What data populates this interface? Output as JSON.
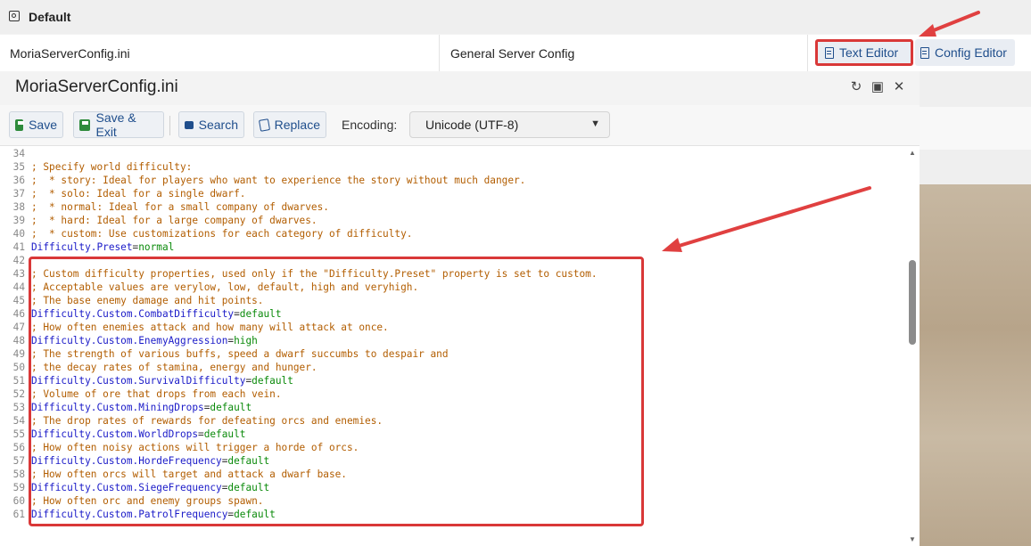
{
  "header": {
    "title": "Default"
  },
  "config_row": {
    "filename": "MoriaServerConfig.ini",
    "description": "General Server Config",
    "text_editor_label": "Text Editor",
    "config_editor_label": "Config Editor"
  },
  "editor": {
    "window_title": "MoriaServerConfig.ini",
    "toolbar": {
      "save": "Save",
      "save_exit": "Save & Exit",
      "search": "Search",
      "replace": "Replace",
      "encoding_label": "Encoding:",
      "encoding_value": "Unicode (UTF-8)"
    },
    "lines": [
      {
        "n": "34",
        "type": "blank",
        "text": ""
      },
      {
        "n": "35",
        "type": "comment",
        "text": "; Specify world difficulty:"
      },
      {
        "n": "36",
        "type": "comment",
        "text": ";  * story: Ideal for players who want to experience the story without much danger."
      },
      {
        "n": "37",
        "type": "comment",
        "text": ";  * solo: Ideal for a single dwarf."
      },
      {
        "n": "38",
        "type": "comment",
        "text": ";  * normal: Ideal for a small company of dwarves."
      },
      {
        "n": "39",
        "type": "comment",
        "text": ";  * hard: Ideal for a large company of dwarves."
      },
      {
        "n": "40",
        "type": "comment",
        "text": ";  * custom: Use customizations for each category of difficulty."
      },
      {
        "n": "41",
        "type": "kv",
        "key": "Difficulty.Preset",
        "value": "normal"
      },
      {
        "n": "42",
        "type": "blank",
        "text": ""
      },
      {
        "n": "43",
        "type": "comment",
        "text": "; Custom difficulty properties, used only if the \"Difficulty.Preset\" property is set to custom."
      },
      {
        "n": "44",
        "type": "comment",
        "text": "; Acceptable values are verylow, low, default, high and veryhigh."
      },
      {
        "n": "45",
        "type": "comment",
        "text": "; The base enemy damage and hit points."
      },
      {
        "n": "46",
        "type": "kv",
        "key": "Difficulty.Custom.CombatDifficulty",
        "value": "default"
      },
      {
        "n": "47",
        "type": "comment",
        "text": "; How often enemies attack and how many will attack at once."
      },
      {
        "n": "48",
        "type": "kv",
        "key": "Difficulty.Custom.EnemyAggression",
        "value": "high"
      },
      {
        "n": "49",
        "type": "comment",
        "text": "; The strength of various buffs, speed a dwarf succumbs to despair and"
      },
      {
        "n": "50",
        "type": "comment",
        "text": "; the decay rates of stamina, energy and hunger."
      },
      {
        "n": "51",
        "type": "kv",
        "key": "Difficulty.Custom.SurvivalDifficulty",
        "value": "default"
      },
      {
        "n": "52",
        "type": "comment",
        "text": "; Volume of ore that drops from each vein."
      },
      {
        "n": "53",
        "type": "kv",
        "key": "Difficulty.Custom.MiningDrops",
        "value": "default"
      },
      {
        "n": "54",
        "type": "comment",
        "text": "; The drop rates of rewards for defeating orcs and enemies."
      },
      {
        "n": "55",
        "type": "kv",
        "key": "Difficulty.Custom.WorldDrops",
        "value": "default"
      },
      {
        "n": "56",
        "type": "comment",
        "text": "; How often noisy actions will trigger a horde of orcs."
      },
      {
        "n": "57",
        "type": "kv",
        "key": "Difficulty.Custom.HordeFrequency",
        "value": "default"
      },
      {
        "n": "58",
        "type": "comment",
        "text": "; How often orcs will target and attack a dwarf base."
      },
      {
        "n": "59",
        "type": "kv",
        "key": "Difficulty.Custom.SiegeFrequency",
        "value": "default"
      },
      {
        "n": "60",
        "type": "comment",
        "text": "; How often orc and enemy groups spawn."
      },
      {
        "n": "61",
        "type": "kv",
        "key": "Difficulty.Custom.PatrolFrequency",
        "value": "default"
      }
    ]
  },
  "colors": {
    "comment": "#b25d00",
    "key": "#1a1ac8",
    "value": "#0a8a0a",
    "highlight": "#d93838",
    "link": "#1f4e8c"
  }
}
